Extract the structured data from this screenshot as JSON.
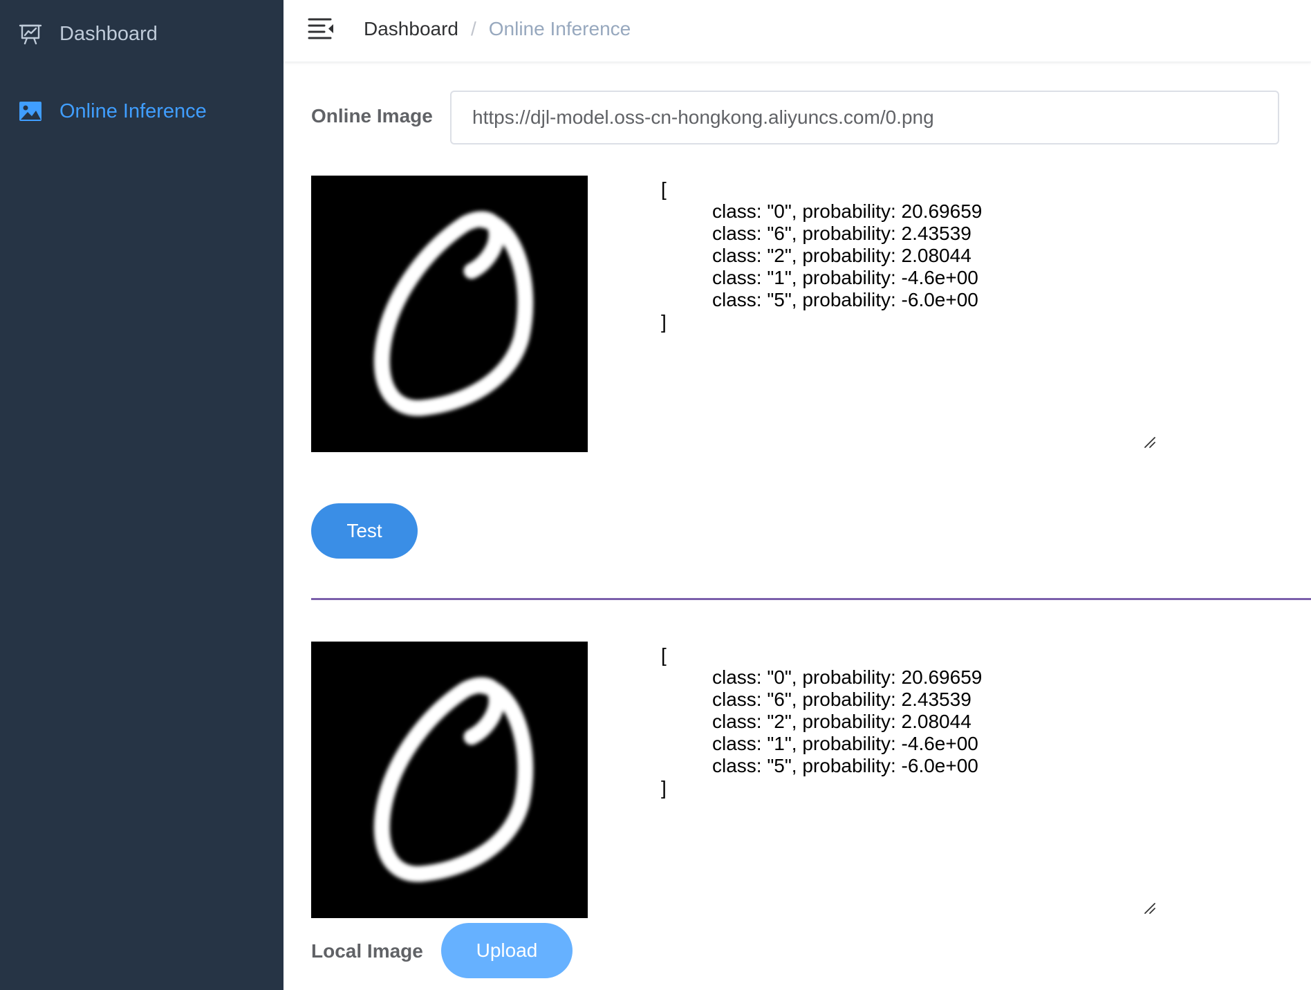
{
  "sidebar": {
    "items": [
      {
        "label": "Dashboard",
        "icon": "presentation-chart-icon",
        "active": false
      },
      {
        "label": "Online Inference",
        "icon": "image-icon",
        "active": true
      }
    ]
  },
  "header": {
    "breadcrumb": {
      "home": "Dashboard",
      "separator": "/",
      "current": "Online Inference"
    }
  },
  "online": {
    "label": "Online Image",
    "url": "https://djl-model.oss-cn-hongkong.aliyuncs.com/0.png",
    "result": {
      "open": "[",
      "lines": [
        "class: \"0\", probability: 20.69659",
        "class: \"6\", probability: 2.43539",
        "class: \"2\", probability: 2.08044",
        "class: \"1\", probability: -4.6e+00",
        "class: \"5\", probability: -6.0e+00"
      ],
      "close": "]"
    },
    "test_label": "Test"
  },
  "local": {
    "label": "Local Image",
    "upload_label": "Upload",
    "result": {
      "open": "[",
      "lines": [
        "class: \"0\", probability: 20.69659",
        "class: \"6\", probability: 2.43539",
        "class: \"2\", probability: 2.08044",
        "class: \"1\", probability: -4.6e+00",
        "class: \"5\", probability: -6.0e+00"
      ],
      "close": "]"
    }
  },
  "colors": {
    "sidebar_bg": "#263445",
    "accent": "#409eff",
    "test_button": "#3a8ee6",
    "upload_button": "#66b1ff",
    "divider": "#7b5fab"
  }
}
